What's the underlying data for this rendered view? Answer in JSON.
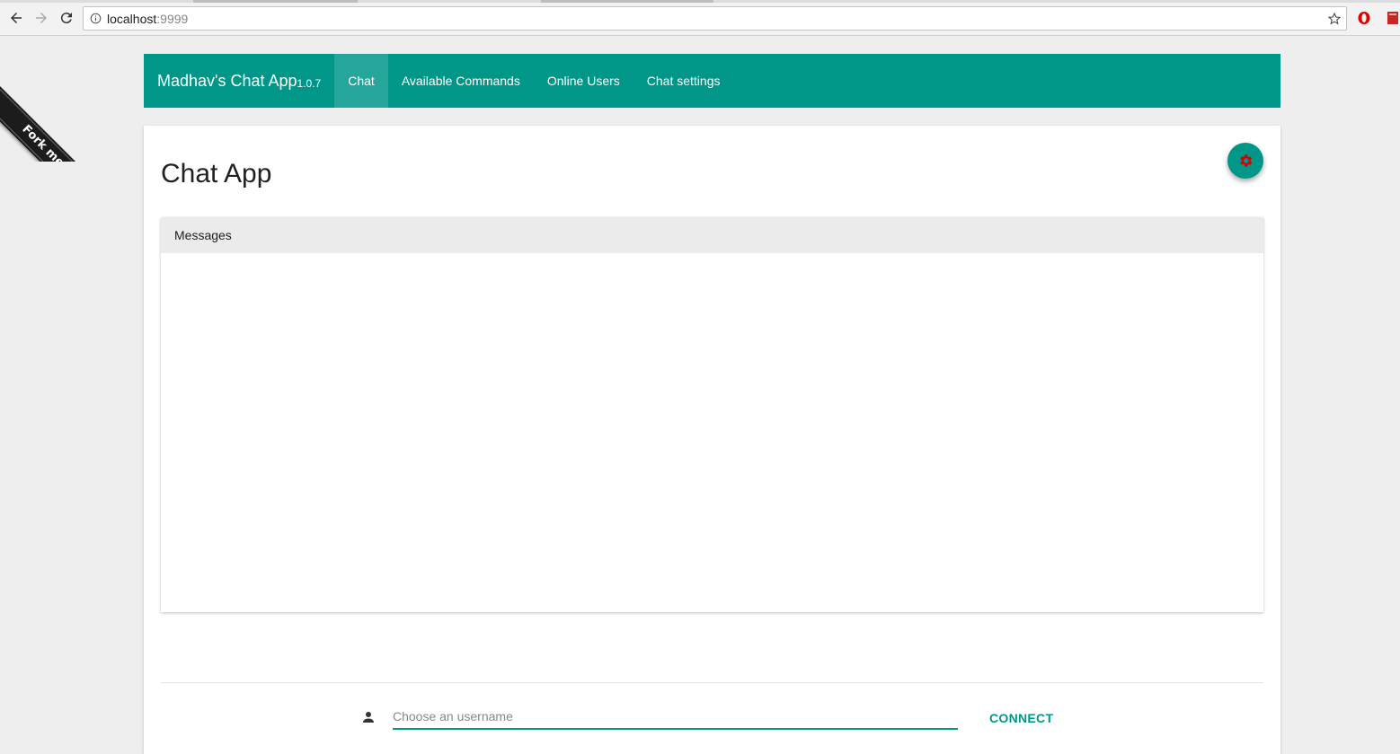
{
  "browser": {
    "url_host": "localhost",
    "url_port": ":9999"
  },
  "ribbon": {
    "text": "Fork me on GitHub"
  },
  "nav": {
    "brand": "Madhav's Chat App",
    "version": "1.0.7",
    "items": [
      {
        "label": "Chat",
        "active": true
      },
      {
        "label": "Available Commands",
        "active": false
      },
      {
        "label": "Online Users",
        "active": false
      },
      {
        "label": "Chat settings",
        "active": false
      }
    ]
  },
  "main": {
    "title": "Chat App",
    "messages_header": "Messages",
    "username_placeholder": "Choose an username",
    "username_value": "",
    "connect_label": "CONNECT"
  },
  "icons": {
    "fab": "gear-icon",
    "user": "person-icon"
  },
  "colors": {
    "primary": "#009688",
    "primary_active": "#26a69a",
    "fab_gear": "#d50000"
  }
}
